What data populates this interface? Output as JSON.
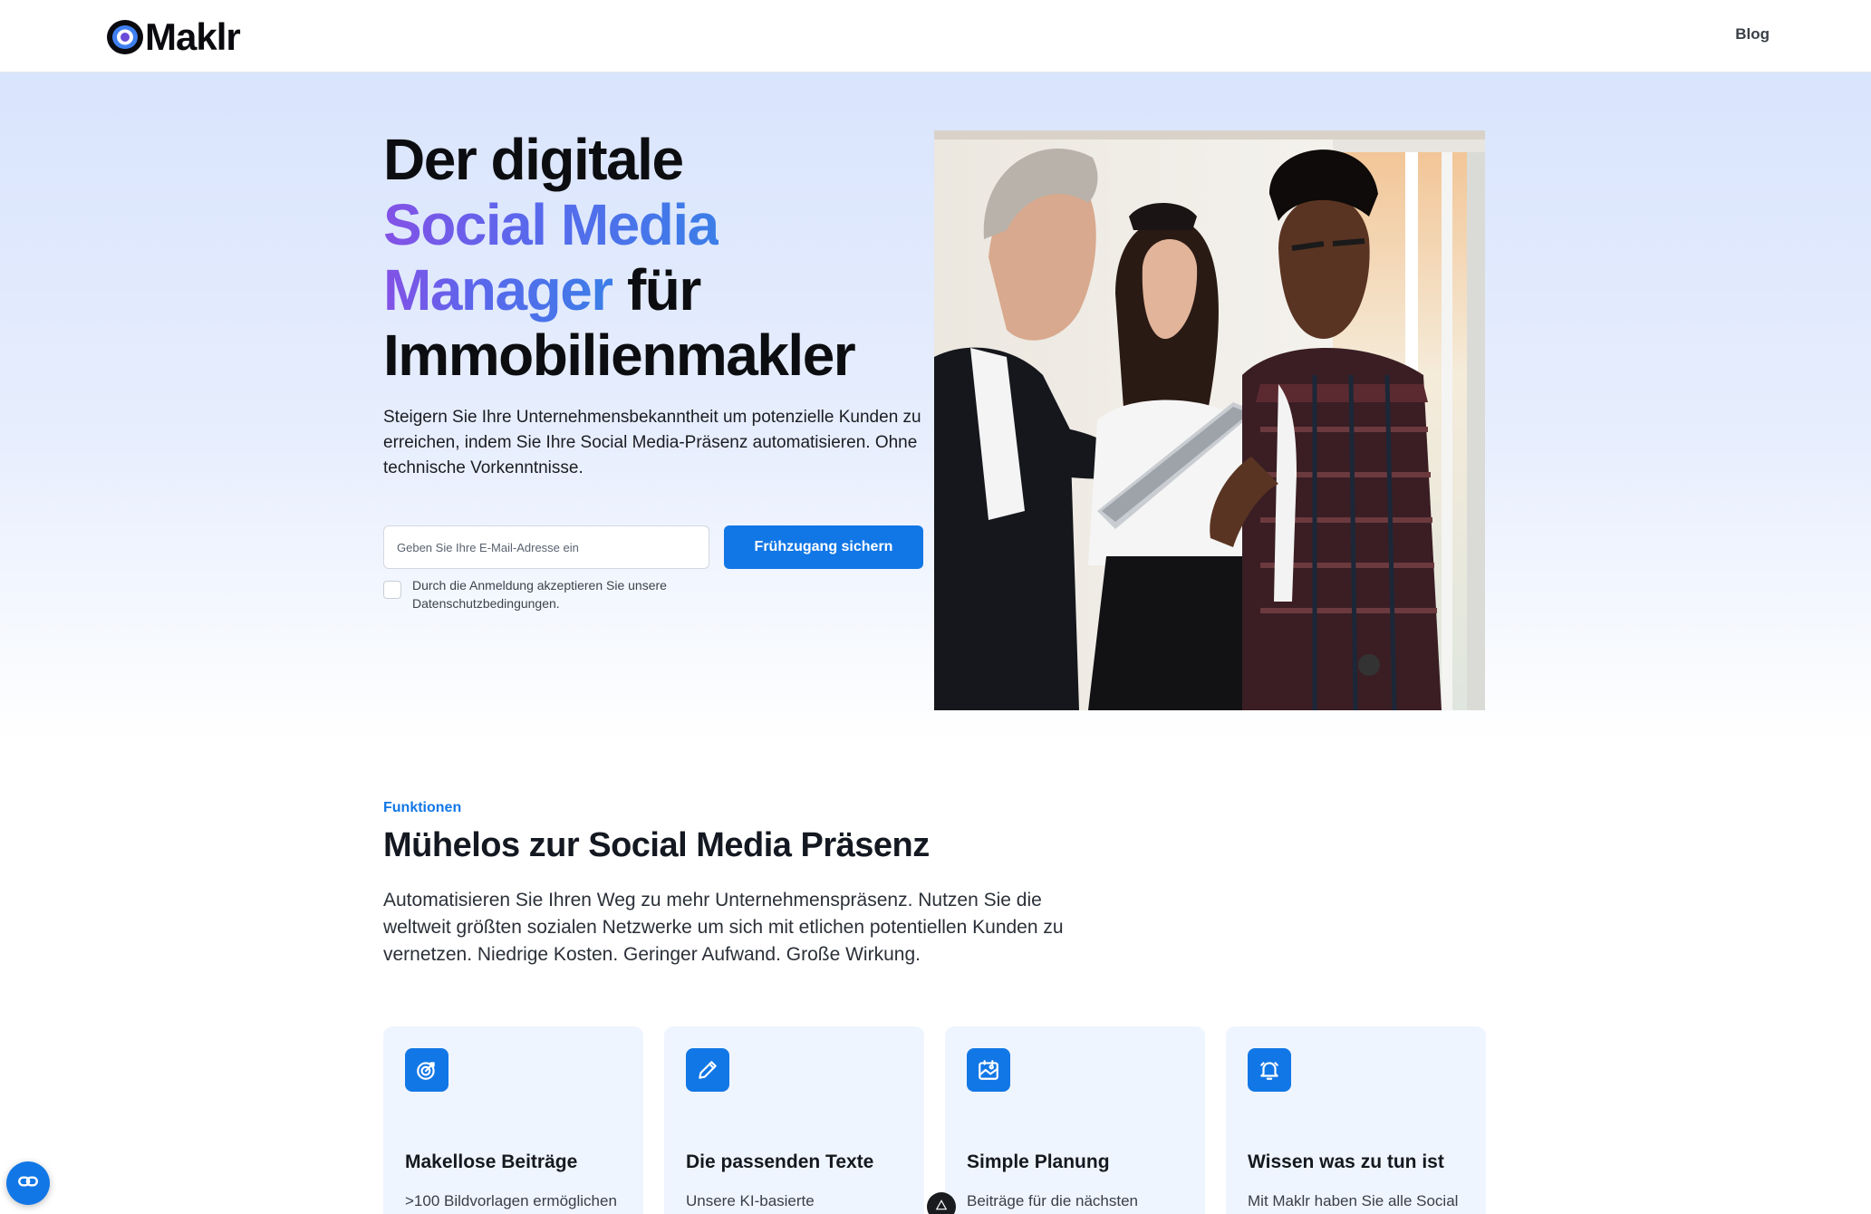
{
  "header": {
    "logo_text": "Maklr",
    "nav_blog": "Blog"
  },
  "hero": {
    "title_line1": "Der digitale",
    "title_highlight_1": "Social Media",
    "title_highlight_2": "Manager",
    "title_line3_rest": " für",
    "title_line4": "Immobilienmakler",
    "subtitle": "Steigern Sie Ihre Unternehmensbekanntheit um potenzielle Kunden zu erreichen, indem Sie Ihre Social Media-Präsenz automatisieren. Ohne technische Vorkenntnisse.",
    "email_placeholder": "Geben Sie Ihre E-Mail-Adresse ein",
    "email_value": "",
    "cta_label": "Frühzugang sichern",
    "consent_text": "Durch die Anmeldung akzeptieren Sie unsere Datenschutzbedingungen.",
    "consent_checked": false
  },
  "features": {
    "kicker": "Funktionen",
    "title": "Mühelos zur Social Media Präsenz",
    "text": "Automatisieren Sie Ihren Weg zu mehr Unternehmenspräsenz. Nutzen Sie die weltweit größten sozialen Netzwerke um sich mit etlichen potentiellen Kunden zu vernetzen. Niedrige Kosten. Geringer Aufwand. Große Wirkung.",
    "cards": [
      {
        "icon": "target-icon",
        "title": "Makellose Beiträge",
        "text": ">100 Bildvorlagen ermöglichen"
      },
      {
        "icon": "pencil-icon",
        "title": "Die passenden Texte",
        "text": "Unsere KI-basierte"
      },
      {
        "icon": "calendar-image-icon",
        "title": "Simple Planung",
        "text": "Beiträge für die nächsten"
      },
      {
        "icon": "bell-icon",
        "title": "Wissen was zu tun ist",
        "text": "Mit Maklr haben Sie alle Social"
      }
    ]
  },
  "colors": {
    "accent": "#1277e6",
    "gradient_start": "#8451e6",
    "gradient_end": "#3b7ee8",
    "hero_bg": "#d9e4fd",
    "card_bg": "#eff5fe"
  }
}
